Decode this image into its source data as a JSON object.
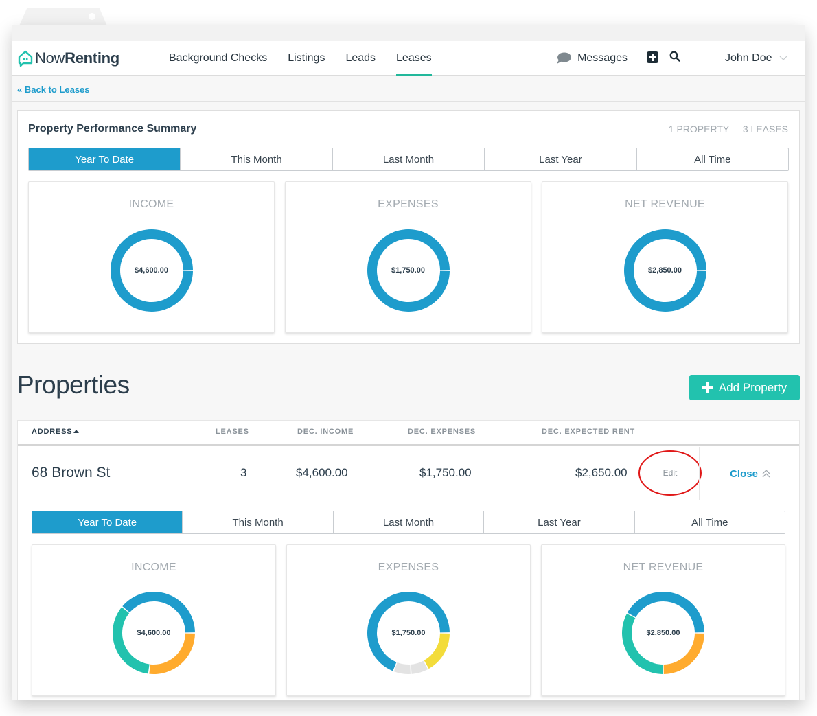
{
  "app": {
    "brand_light": "Now",
    "brand_bold": "Renting",
    "colors": {
      "primary_blue": "#1e9ccc",
      "teal_accent": "#22b89b",
      "add_button": "#22c2ae",
      "orange": "#ffab2e",
      "teal": "#22c2ae",
      "yellow": "#f3dc3b",
      "light_gray": "#e3e3e3",
      "annotation_red": "#e01818"
    }
  },
  "nav": {
    "links": [
      {
        "label": "Background Checks",
        "active": false
      },
      {
        "label": "Listings",
        "active": false
      },
      {
        "label": "Leads",
        "active": false
      },
      {
        "label": "Leases",
        "active": true
      }
    ],
    "messages_label": "Messages",
    "icons": {
      "messages": "speech-bubble-icon",
      "add": "plus-square-icon",
      "search": "search-icon",
      "user_menu": "chevron-down-icon"
    },
    "user_name": "John Doe"
  },
  "back_link": "« Back to Leases",
  "summary": {
    "title": "Property Performance Summary",
    "property_count": "1 PROPERTY",
    "lease_count": "3 LEASES",
    "tabs": [
      "Year To Date",
      "This Month",
      "Last Month",
      "Last Year",
      "All Time"
    ],
    "active_tab": 0,
    "cards": [
      {
        "title": "INCOME",
        "value": "$4,600.00"
      },
      {
        "title": "EXPENSES",
        "value": "$1,750.00"
      },
      {
        "title": "NET REVENUE",
        "value": "$2,850.00"
      }
    ]
  },
  "properties": {
    "title": "Properties",
    "add_button": "Add Property",
    "columns": [
      "ADDRESS",
      "LEASES",
      "DEC. INCOME",
      "DEC. EXPENSES",
      "DEC. EXPECTED RENT"
    ],
    "sort_column": "ADDRESS",
    "sort_direction": "ascending",
    "rows": [
      {
        "address": "68 Brown St",
        "leases": "3",
        "income": "$4,600.00",
        "expenses": "$1,750.00",
        "expected_rent": "$2,650.00",
        "edit_label": "Edit",
        "close_label": "Close"
      }
    ],
    "detail": {
      "tabs": [
        "Year To Date",
        "This Month",
        "Last Month",
        "Last Year",
        "All Time"
      ],
      "active_tab": 0,
      "cards": [
        {
          "title": "INCOME",
          "value": "$4,600.00"
        },
        {
          "title": "EXPENSES",
          "value": "$1,750.00"
        },
        {
          "title": "NET REVENUE",
          "value": "$2,850.00"
        }
      ]
    }
  },
  "chart_data": [
    {
      "type": "pie",
      "title": "INCOME (summary)",
      "center_label": "$4,600.00",
      "slices": [
        {
          "color": "#1e9ccc",
          "share": 1.0
        }
      ]
    },
    {
      "type": "pie",
      "title": "EXPENSES (summary)",
      "center_label": "$1,750.00",
      "slices": [
        {
          "color": "#1e9ccc",
          "share": 1.0
        }
      ]
    },
    {
      "type": "pie",
      "title": "NET REVENUE (summary)",
      "center_label": "$2,850.00",
      "slices": [
        {
          "color": "#1e9ccc",
          "share": 1.0
        }
      ]
    },
    {
      "type": "pie",
      "title": "INCOME (68 Brown St)",
      "center_label": "$4,600.00",
      "slices": [
        {
          "color": "#ffab2e",
          "share": 0.27
        },
        {
          "color": "#22c2ae",
          "share": 0.34
        },
        {
          "color": "#1e9ccc",
          "share": 0.39
        }
      ]
    },
    {
      "type": "pie",
      "title": "EXPENSES (68 Brown St)",
      "center_label": "$1,750.00",
      "slices": [
        {
          "color": "#f3dc3b",
          "share": 0.17
        },
        {
          "color": "#e3e3e3",
          "share": 0.07
        },
        {
          "color": "#e3e3e3",
          "share": 0.07
        },
        {
          "color": "#1e9ccc",
          "share": 0.69
        }
      ]
    },
    {
      "type": "pie",
      "title": "NET REVENUE (68 Brown St)",
      "center_label": "$2,850.00",
      "slices": [
        {
          "color": "#ffab2e",
          "share": 0.25
        },
        {
          "color": "#22c2ae",
          "share": 0.33
        },
        {
          "color": "#1e9ccc",
          "share": 0.42
        }
      ]
    }
  ]
}
